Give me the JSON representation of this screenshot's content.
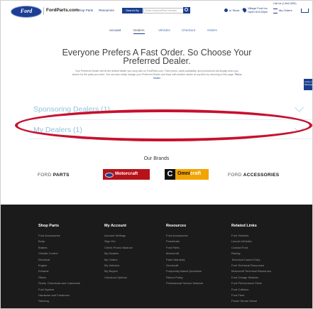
{
  "header": {
    "logo_text": "Ford",
    "brand": "FordParts.com",
    "nav": [
      "Shop Parts",
      "Resources"
    ],
    "search_by": "Search By",
    "search_placeholder": "Enter Keyword/Part Number",
    "in_stock": "In Stock",
    "store_line1": "Village Ford Inc",
    "store_line2": "Open til 6:00pm",
    "orders": "My Orders",
    "call_us": "Call Us (1-844-0000)"
  },
  "subnav": {
    "items": [
      "Account",
      "Dealers",
      "Vehicles",
      "Checkout",
      "Orders"
    ]
  },
  "main": {
    "heading": "Everyone Prefers A Fast Order. So Choose Your Preferred Dealer.",
    "description": "Your Preferred Dealer will be the default dealer you shop with on FordParts.com. Their prices, parts availability, and promotions will display when you search for the parts you need. You can also easily change your Preferred Dealer and shop with another dealer at any time by returning to this page.",
    "desc_link": "Find a Dealer",
    "side_tab": "Leave a Message",
    "accordion": [
      {
        "label": "Sponsoring Dealers (1)"
      },
      {
        "label": "My Dealers (1)"
      }
    ]
  },
  "brands": {
    "title": "Our Brands",
    "ford_parts": [
      "FORD",
      "PARTS"
    ],
    "motorcraft": "Motorcraft",
    "omnicraft": [
      "Omni",
      "craft"
    ],
    "ford_accessories": [
      "FORD",
      "ACCESSORIES"
    ]
  },
  "footer": {
    "columns": [
      {
        "heading": "Shop Parts",
        "links": [
          "Ford Accessories",
          "Body",
          "Brakes",
          "Climate Control",
          "Electrical",
          "Engine",
          "Exhaust",
          "Filters",
          "Fluids, Chemicals and Lubricants",
          "Fuel System",
          "Hardware and Fasteners",
          "Steering"
        ]
      },
      {
        "heading": "My Account",
        "links": [
          "Account Settings",
          "Sign Out",
          "Check Promo Balance",
          "My Dealers",
          "My Orders",
          "My Vehicles",
          "My Buyers",
          "Checkout Options"
        ]
      },
      {
        "heading": "Resources",
        "links": [
          "Ford Accessories",
          "Powertrain",
          "Ford Parts",
          "Motorcraft",
          "Parts Warranty",
          "Omnicraft",
          "Frequently Asked Questions",
          "Return Policy",
          "Professional Service Network"
        ]
      },
      {
        "heading": "Related Links",
        "links": [
          "Ford Vehicles",
          "Lincoln Vehicles",
          "Contact Ford",
          "Racing",
          "Technical Career Entry",
          "Ford Technical Resources",
          "Motorcraft Technical Resources",
          "Ford Charge Stations",
          "Ford Performance Parts",
          "Ford Collision",
          "Ford Fleet",
          "Power Stroke Diesel"
        ]
      }
    ]
  }
}
